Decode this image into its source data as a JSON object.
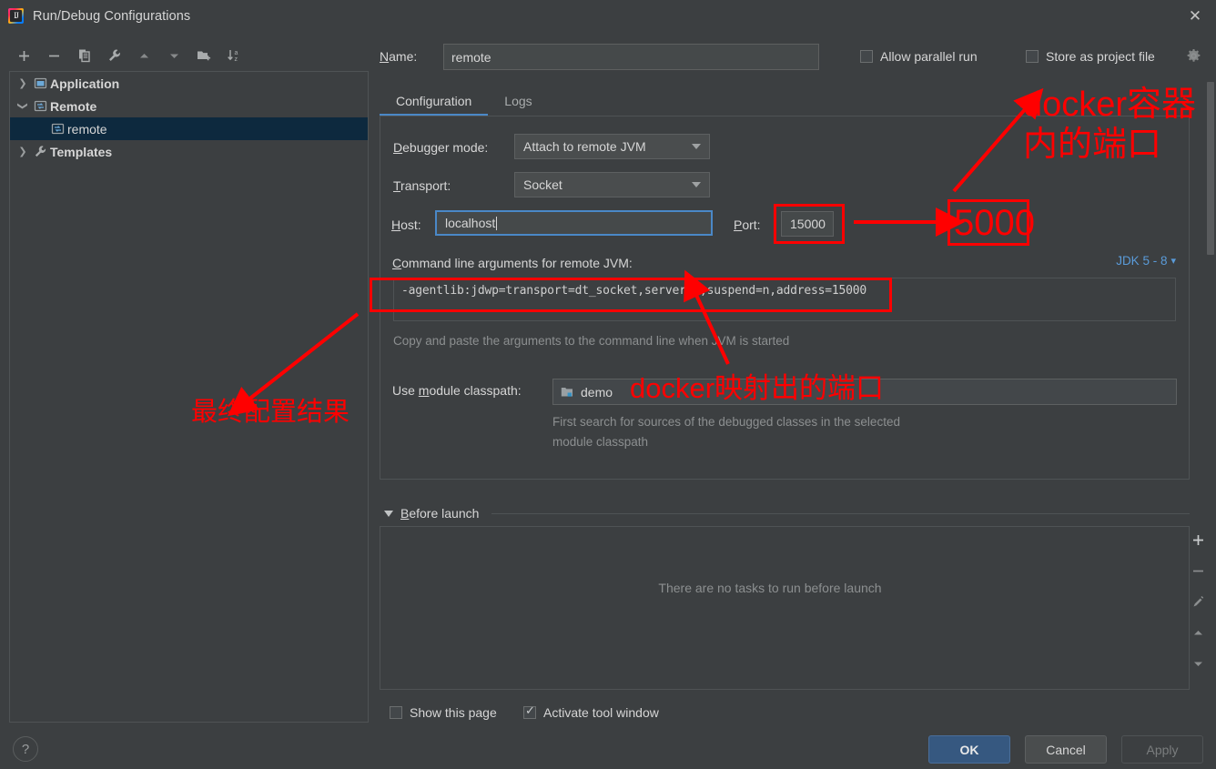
{
  "window": {
    "title": "Run/Debug Configurations",
    "close_label": "✕",
    "app_icon": "intellij-idea-icon"
  },
  "sidebar": {
    "toolbar": [
      {
        "name": "add-configuration-button",
        "icon": "plus-icon"
      },
      {
        "name": "remove-configuration-button",
        "icon": "minus-icon"
      },
      {
        "name": "copy-configuration-button",
        "icon": "copy-icon"
      },
      {
        "name": "edit-templates-button",
        "icon": "wrench-icon"
      },
      {
        "name": "move-up-button",
        "icon": "arrow-up-icon"
      },
      {
        "name": "move-down-button",
        "icon": "arrow-down-icon"
      },
      {
        "name": "new-folder-button",
        "icon": "folder-add-icon"
      },
      {
        "name": "sort-button",
        "icon": "sort-az-icon"
      }
    ],
    "tree": [
      {
        "label": "Application",
        "arrow": "collapsed",
        "icon": "application-icon",
        "level": 0,
        "bold": true,
        "selected": false
      },
      {
        "label": "Remote",
        "arrow": "expanded",
        "icon": "remote-icon",
        "level": 0,
        "bold": true,
        "selected": false
      },
      {
        "label": "remote",
        "arrow": "none",
        "icon": "remote-icon",
        "level": 1,
        "bold": false,
        "selected": true
      },
      {
        "label": "Templates",
        "arrow": "collapsed",
        "icon": "wrench-icon",
        "level": 0,
        "bold": true,
        "selected": false
      }
    ],
    "help_label": "?"
  },
  "form": {
    "name_label": "Name:",
    "name_value": "remote",
    "allow_parallel_run": {
      "label": "Allow parallel run",
      "checked": false
    },
    "store_as_project_file": {
      "label": "Store as project file",
      "checked": false
    },
    "gear_icon": "gear-icon",
    "tabs": [
      {
        "label": "Configuration",
        "active": true
      },
      {
        "label": "Logs",
        "active": false
      }
    ],
    "debugger_mode_label": "Debugger mode:",
    "debugger_mode_value": "Attach to remote JVM",
    "transport_label": "Transport:",
    "transport_value": "Socket",
    "host_label": "Host:",
    "host_value": "localhost",
    "port_label": "Port:",
    "port_value": "15000",
    "cmd_args_label": "Command line arguments for remote JVM:",
    "cmd_args_value": "-agentlib:jdwp=transport=dt_socket,server=y,suspend=n,address=15000",
    "cmd_args_hint": "Copy and paste the arguments to the command line when JVM is started",
    "jdk_link": "JDK 5 - 8",
    "module_classpath_label": "Use module classpath:",
    "module_classpath_value": "demo",
    "module_hint_line1": "First search for sources of the debugged classes in the selected",
    "module_hint_line2": "module classpath"
  },
  "before_launch": {
    "title": "Before launch",
    "empty_text": "There are no tasks to run before launch",
    "side_buttons": [
      {
        "name": "add-task-button",
        "icon": "plus-icon"
      },
      {
        "name": "remove-task-button",
        "icon": "minus-icon"
      },
      {
        "name": "edit-task-button",
        "icon": "pencil-icon"
      },
      {
        "name": "move-task-up-button",
        "icon": "arrow-up-icon"
      },
      {
        "name": "move-task-down-button",
        "icon": "arrow-down-icon"
      }
    ],
    "show_this_page": {
      "label": "Show this page",
      "checked": false
    },
    "activate_tool_window": {
      "label": "Activate tool window",
      "checked": true
    }
  },
  "footer": {
    "ok_label": "OK",
    "cancel_label": "Cancel",
    "apply_label": "Apply"
  },
  "annotations": {
    "color": "#ff0000",
    "container_port_note_line1": "docker容器",
    "container_port_note_line2": "内的端口",
    "container_port_value": "5000",
    "mapped_port_note": "docker映射出的端口",
    "final_result_note": "最终配置结果"
  }
}
